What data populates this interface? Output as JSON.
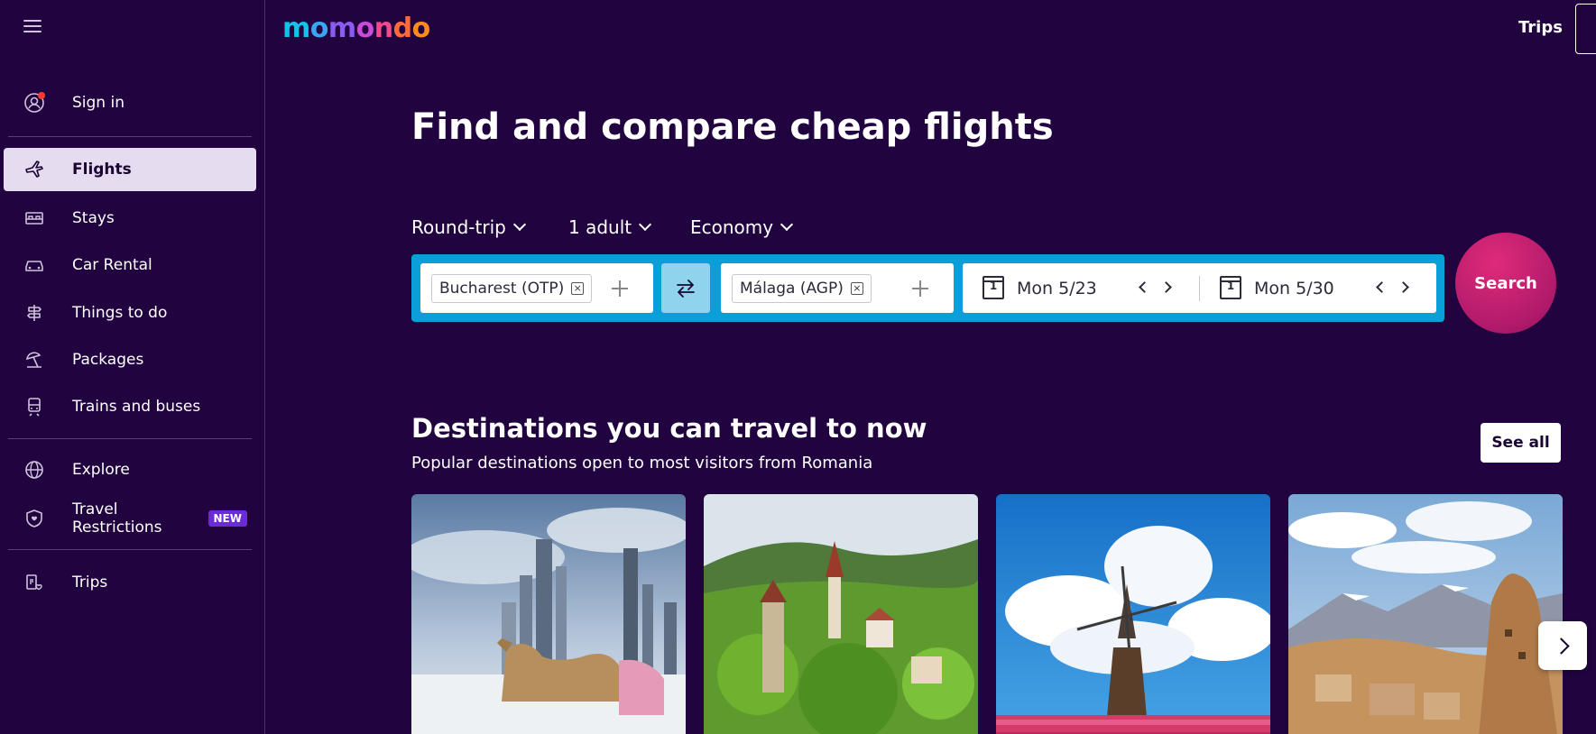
{
  "logo": {
    "text": "momondo",
    "letters": [
      {
        "ch": "m",
        "color": "#16c2e6"
      },
      {
        "ch": "o",
        "color": "#3aa5f0"
      },
      {
        "ch": "m",
        "color": "#8a5cf0"
      },
      {
        "ch": "o",
        "color": "#c94cd6"
      },
      {
        "ch": "n",
        "color": "#f04b8b"
      },
      {
        "ch": "d",
        "color": "#ff6a3d"
      },
      {
        "ch": "o",
        "color": "#ff8c1a"
      }
    ]
  },
  "header": {
    "trips_label": "Trips"
  },
  "sidebar": {
    "sign_in": "Sign in",
    "items": [
      {
        "label": "Flights",
        "icon": "plane-icon",
        "active": true
      },
      {
        "label": "Stays",
        "icon": "bed-icon"
      },
      {
        "label": "Car Rental",
        "icon": "car-icon"
      },
      {
        "label": "Things to do",
        "icon": "signpost-icon"
      },
      {
        "label": "Packages",
        "icon": "beach-umbrella-icon"
      },
      {
        "label": "Trains and buses",
        "icon": "train-icon"
      }
    ],
    "explore": "Explore",
    "travel_restrictions_line1": "Travel",
    "travel_restrictions_line2": "Restrictions",
    "new_badge": "NEW",
    "trips": "Trips"
  },
  "hero": {
    "title": "Find and compare cheap flights"
  },
  "options": {
    "trip_type": "Round-trip",
    "travelers": "1 adult",
    "cabin": "Economy"
  },
  "search": {
    "origin": "Bucharest (OTP)",
    "destination": "Málaga (AGP)",
    "depart_date": "Mon 5/23",
    "return_date": "Mon 5/30",
    "calendar_day": "1",
    "button": "Search"
  },
  "destinations": {
    "title": "Destinations you can travel to now",
    "subtitle": "Popular destinations open to most visitors from Romania",
    "see_all": "See all"
  },
  "colors": {
    "background": "#21033f",
    "search_bar": "#0a9fd8",
    "search_button": "#c4207a",
    "active_nav": "#e6dcef"
  }
}
